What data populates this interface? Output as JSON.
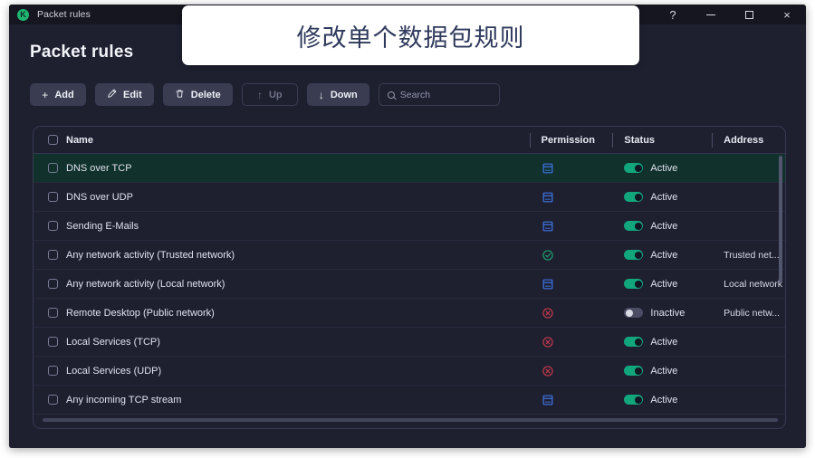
{
  "window": {
    "app_icon_letter": "K",
    "title": "Packet rules",
    "controls": {
      "help": "?",
      "minimize": "–",
      "maximize": "□",
      "close": "×"
    }
  },
  "page": {
    "heading": "Packet rules"
  },
  "toolbar": {
    "add": {
      "icon": "+",
      "label": "Add"
    },
    "edit": {
      "icon": "✎",
      "label": "Edit"
    },
    "delete": {
      "icon": "🗑",
      "label": "Delete"
    },
    "up": {
      "icon": "↑",
      "label": "Up",
      "disabled": true
    },
    "down": {
      "icon": "↓",
      "label": "Down",
      "disabled": false
    },
    "search": {
      "placeholder": "Search",
      "value": ""
    }
  },
  "table": {
    "columns": [
      "Name",
      "Permission",
      "Status",
      "Address"
    ],
    "rows": [
      {
        "name": "DNS over TCP",
        "permission": "prompt",
        "status": "Active",
        "status_on": true,
        "address": "",
        "selected": true
      },
      {
        "name": "DNS over UDP",
        "permission": "prompt",
        "status": "Active",
        "status_on": true,
        "address": "",
        "selected": false
      },
      {
        "name": "Sending E-Mails",
        "permission": "prompt",
        "status": "Active",
        "status_on": true,
        "address": "",
        "selected": false
      },
      {
        "name": "Any network activity (Trusted network)",
        "permission": "allow",
        "status": "Active",
        "status_on": true,
        "address": "Trusted net...",
        "selected": false
      },
      {
        "name": "Any network activity (Local network)",
        "permission": "prompt",
        "status": "Active",
        "status_on": true,
        "address": "Local network",
        "selected": false
      },
      {
        "name": "Remote Desktop (Public network)",
        "permission": "block",
        "status": "Inactive",
        "status_on": false,
        "address": "Public netw...",
        "selected": false
      },
      {
        "name": "Local Services (TCP)",
        "permission": "block",
        "status": "Active",
        "status_on": true,
        "address": "",
        "selected": false
      },
      {
        "name": "Local Services (UDP)",
        "permission": "block",
        "status": "Active",
        "status_on": true,
        "address": "",
        "selected": false
      },
      {
        "name": "Any incoming TCP stream",
        "permission": "prompt",
        "status": "Active",
        "status_on": true,
        "address": "",
        "selected": false
      }
    ]
  },
  "callout": {
    "text": "修改单个数据包规则"
  },
  "colors": {
    "accent_green": "#12a67d",
    "allow": "#1f9d6e",
    "block": "#c0394b",
    "prompt": "#3f73e3",
    "selected_row": "#10312c",
    "window_bg": "#1e2030",
    "titlebar_bg": "#15161f"
  }
}
